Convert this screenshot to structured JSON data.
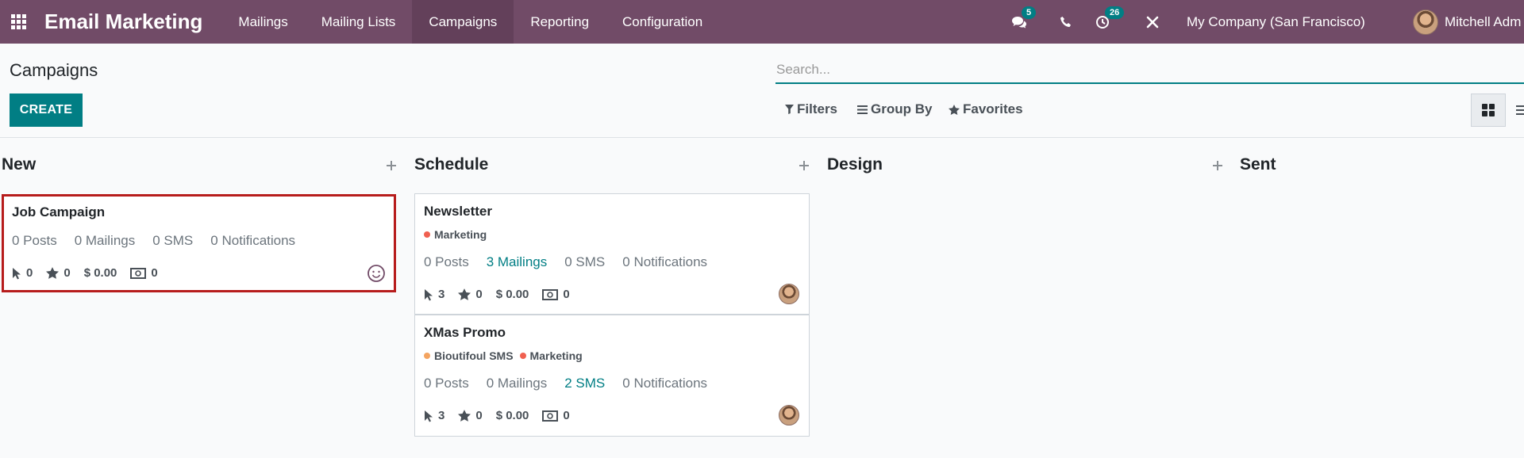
{
  "navbar": {
    "app_title": "Email Marketing",
    "menu": [
      "Mailings",
      "Mailing Lists",
      "Campaigns",
      "Reporting",
      "Configuration"
    ],
    "active_menu": "Campaigns",
    "messages_badge": "5",
    "activities_badge": "26",
    "company": "My Company (San Francisco)",
    "user_name": "Mitchell Adm"
  },
  "control_panel": {
    "title": "Campaigns",
    "create_label": "CREATE",
    "search_placeholder": "Search...",
    "filters_label": "Filters",
    "group_by_label": "Group By",
    "favorites_label": "Favorites"
  },
  "columns": [
    {
      "name": "New",
      "cards": [
        {
          "title": "Job Campaign",
          "tags": [],
          "counts": {
            "posts": "0 Posts",
            "mailings": "0 Mailings",
            "sms": "0 SMS",
            "notifications": "0 Notifications"
          },
          "stats": {
            "clicks": "0",
            "rating": "0",
            "revenue": "$ 0.00",
            "cash": "0"
          },
          "selected": true
        }
      ]
    },
    {
      "name": "Schedule",
      "cards": [
        {
          "title": "Newsletter",
          "tags": [
            {
              "label": "Marketing",
              "color": "#f06050"
            }
          ],
          "counts": {
            "posts": "0 Posts",
            "mailings": "3 Mailings",
            "sms": "0 SMS",
            "notifications": "0 Notifications"
          },
          "stats": {
            "clicks": "3",
            "rating": "0",
            "revenue": "$ 0.00",
            "cash": "0"
          }
        },
        {
          "title": "XMas Promo",
          "tags": [
            {
              "label": "Bioutifoul SMS",
              "color": "#f4a460"
            },
            {
              "label": "Marketing",
              "color": "#f06050"
            }
          ],
          "counts": {
            "posts": "0 Posts",
            "mailings": "0 Mailings",
            "sms": "2 SMS",
            "notifications": "0 Notifications"
          },
          "stats": {
            "clicks": "3",
            "rating": "0",
            "revenue": "$ 0.00",
            "cash": "0"
          }
        }
      ]
    },
    {
      "name": "Design",
      "cards": []
    },
    {
      "name": "Sent",
      "cards": []
    }
  ],
  "colors": {
    "brand": "#714b67",
    "accent": "#017e84",
    "selected_border": "#b71c1c"
  }
}
